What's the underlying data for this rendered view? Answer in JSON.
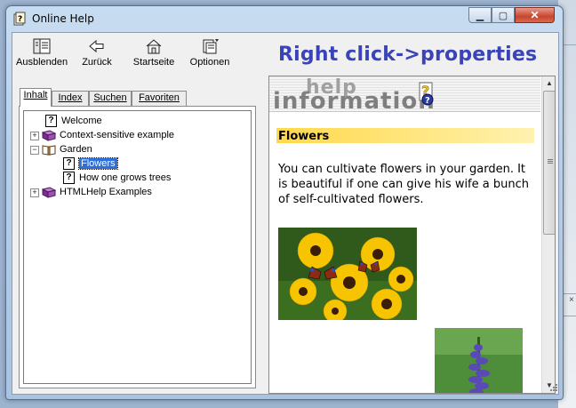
{
  "window": {
    "title": "Online Help"
  },
  "toolbar": {
    "buttons": [
      {
        "label": "Ausblenden",
        "icon": "hide-icon"
      },
      {
        "label": "Zurück",
        "icon": "back-arrow-icon"
      },
      {
        "label": "Startseite",
        "icon": "home-icon"
      },
      {
        "label": "Optionen",
        "icon": "options-icon"
      }
    ],
    "banner": "Right click->properties"
  },
  "tabs": [
    {
      "label": "Inhalt",
      "active": true
    },
    {
      "label": "Index",
      "active": false
    },
    {
      "label": "Suchen",
      "active": false
    },
    {
      "label": "Favoriten",
      "active": false
    }
  ],
  "tree": [
    {
      "label": "Welcome",
      "icon": "help-page-icon",
      "level": 1
    },
    {
      "label": "Context-sensitive example",
      "icon": "closed-book-icon",
      "level": 0,
      "expander": "+"
    },
    {
      "label": "Garden",
      "icon": "open-book-icon",
      "level": 0,
      "expander": "−"
    },
    {
      "label": "Flowers",
      "icon": "help-page-icon",
      "level": 2,
      "selected": true
    },
    {
      "label": "How one grows trees",
      "icon": "help-page-icon",
      "level": 2
    },
    {
      "label": "HTMLHelp Examples",
      "icon": "closed-book-icon",
      "level": 0,
      "expander": "+"
    }
  ],
  "content": {
    "logo_top": "help",
    "logo_bottom": "information",
    "heading": "Flowers",
    "text": "You can cultivate flowers in your garden. It is beautiful if one can give his wife a bunch of self-cultivated flowers."
  },
  "colors": {
    "banner": "#3a44b8",
    "selection": "#2f6fd6",
    "heading_band": "#ffd84a"
  }
}
